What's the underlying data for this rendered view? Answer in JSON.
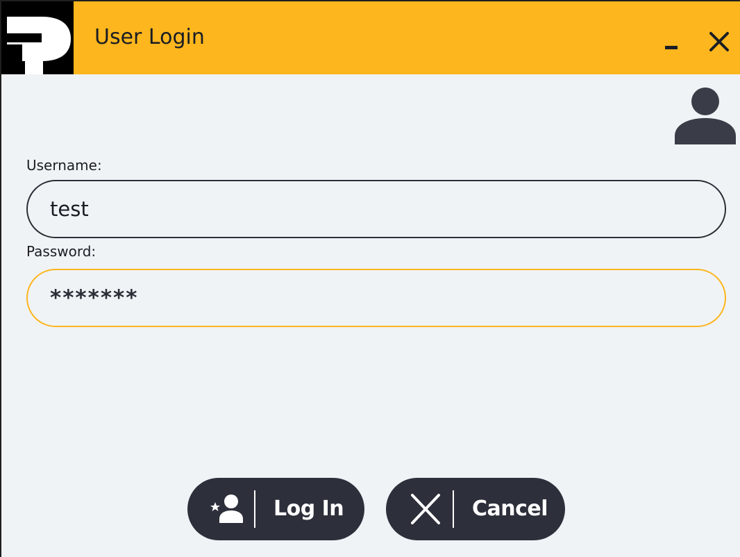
{
  "window": {
    "title": "User Login",
    "logo_icon": "parker-logo-icon",
    "minimize_icon": "minimize-icon",
    "close_icon": "close-icon"
  },
  "form": {
    "avatar_icon": "user-avatar-icon",
    "username_label": "Username:",
    "username_value": "test",
    "password_label": "Password:",
    "password_value": "*******"
  },
  "buttons": {
    "login_label": "Log In",
    "login_icon": "add-user-icon",
    "cancel_label": "Cancel",
    "cancel_icon": "close-icon"
  },
  "colors": {
    "titlebar": "#fdb61d",
    "background": "#f0f3f6",
    "button": "#2d303a",
    "text": "#1a1d24",
    "focus_border": "#fdb61d"
  }
}
